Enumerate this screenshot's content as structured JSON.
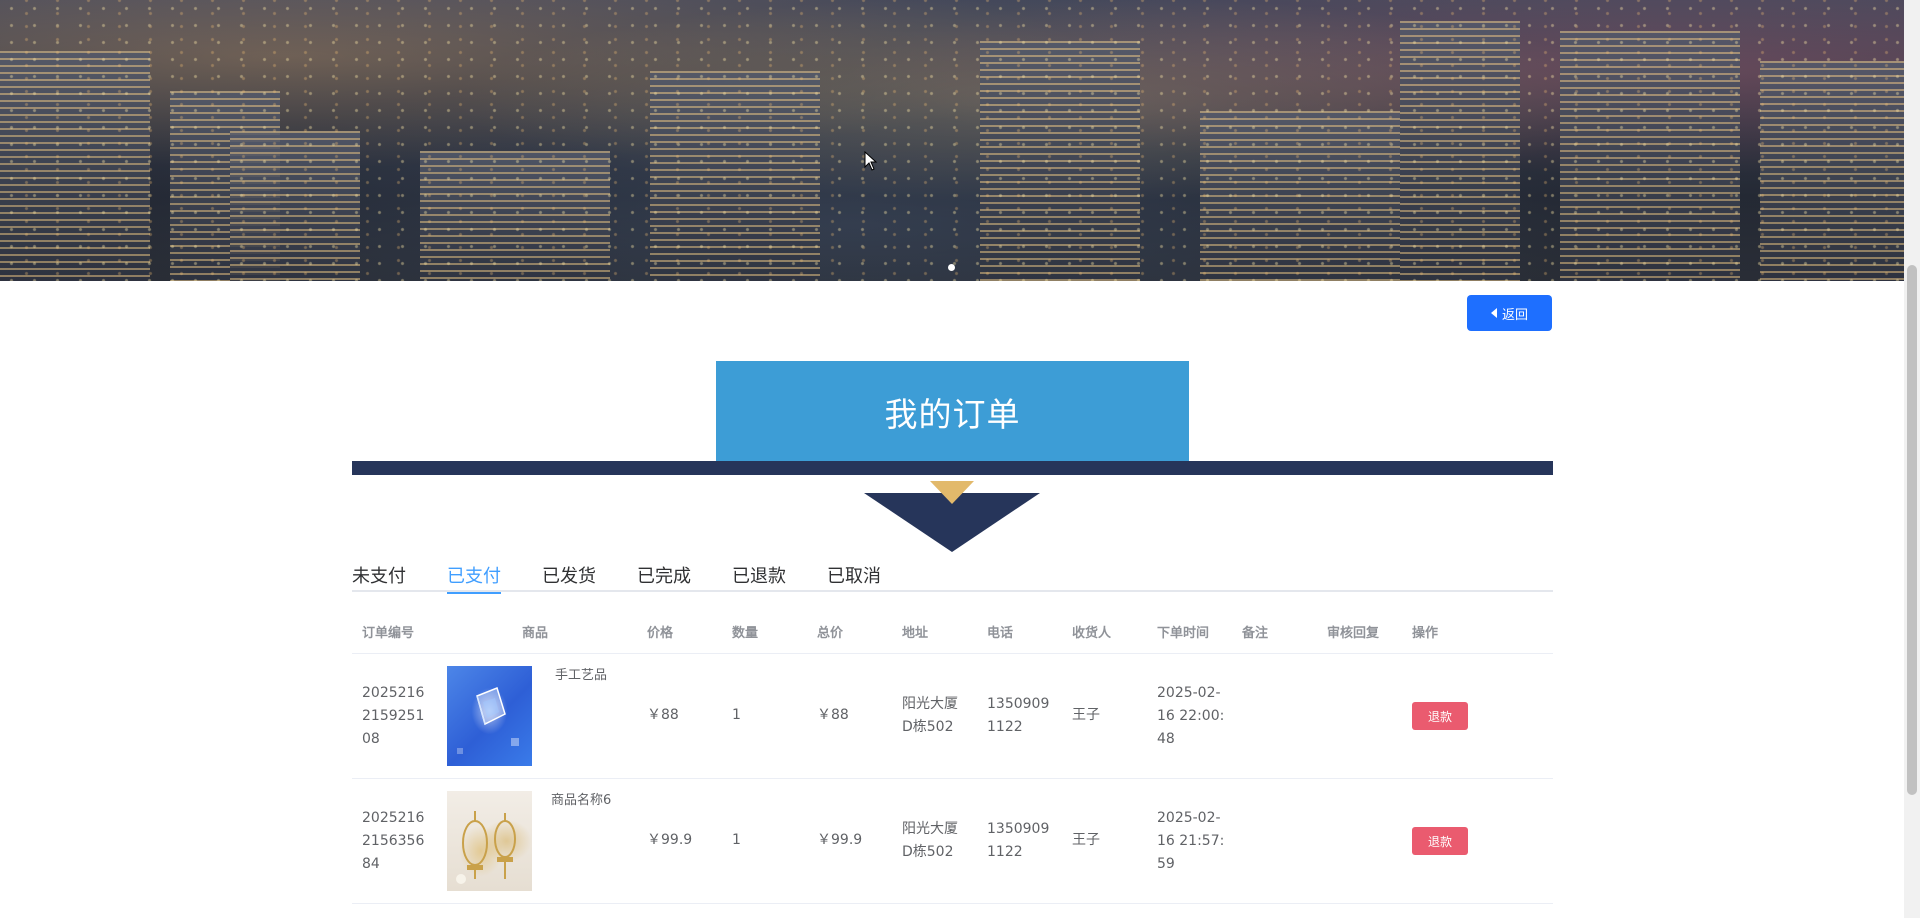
{
  "header": {
    "back_label": "返回"
  },
  "page": {
    "title": "我的订单"
  },
  "tabs": [
    {
      "label": "未支付",
      "active": false
    },
    {
      "label": "已支付",
      "active": true
    },
    {
      "label": "已发货",
      "active": false
    },
    {
      "label": "已完成",
      "active": false
    },
    {
      "label": "已退款",
      "active": false
    },
    {
      "label": "已取消",
      "active": false
    }
  ],
  "table": {
    "columns": [
      "订单编号",
      "商品",
      "价格",
      "数量",
      "总价",
      "地址",
      "电话",
      "收货人",
      "下单时间",
      "备注",
      "审核回复",
      "操作"
    ],
    "rows": [
      {
        "order_no": [
          "2025216",
          "2159251",
          "08"
        ],
        "product_name": "手工艺品",
        "price": "￥88",
        "quantity": "1",
        "total": "￥88",
        "address": [
          "阳光大厦",
          "D栋502"
        ],
        "phone": [
          "1350909",
          "1122"
        ],
        "receiver": "王子",
        "order_time": [
          "2025-02-",
          "16 22:00:",
          "48"
        ],
        "remark": "",
        "review_reply": "",
        "action_label": "退款"
      },
      {
        "order_no": [
          "2025216",
          "2156356",
          "84"
        ],
        "product_name": "商品名称6",
        "price": "￥99.9",
        "quantity": "1",
        "total": "￥99.9",
        "address": [
          "阳光大厦",
          "D栋502"
        ],
        "phone": [
          "1350909",
          "1122"
        ],
        "receiver": "王子",
        "order_time": [
          "2025-02-",
          "16 21:57:",
          "59"
        ],
        "remark": "",
        "review_reply": "",
        "action_label": "退款"
      }
    ]
  },
  "colors": {
    "accent_blue": "#409eff",
    "button_blue": "#1e6fff",
    "title_blue": "#3d9dd6",
    "navy": "#26355a",
    "gold": "#e2b96b",
    "refund_red": "#ea5b6f"
  },
  "icons": {
    "back": "caret-left-icon",
    "cursor": "mouse-pointer-icon"
  }
}
